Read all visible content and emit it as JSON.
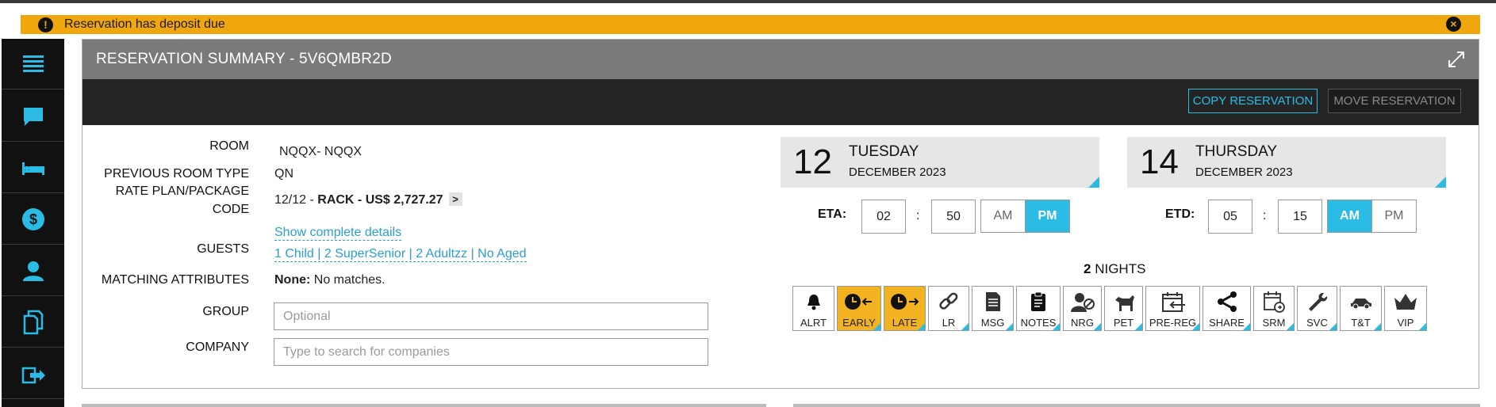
{
  "alert": {
    "text": "Reservation has deposit due",
    "icon": "exclamation-icon",
    "close_icon": "close-icon"
  },
  "sidebar": {
    "items": [
      {
        "icon": "menu-icon"
      },
      {
        "icon": "chat-icon"
      },
      {
        "icon": "bed-icon"
      },
      {
        "icon": "dollar-icon"
      },
      {
        "icon": "user-icon"
      },
      {
        "icon": "documents-icon"
      },
      {
        "icon": "export-icon"
      }
    ]
  },
  "header": {
    "title": "RESERVATION SUMMARY - 5V6QMBR2D",
    "copy_label": "COPY RESERVATION",
    "move_label": "MOVE RESERVATION"
  },
  "details": {
    "room_label": "ROOM",
    "room_value": "NQQX- NQQX",
    "prev_room_type_label": "PREVIOUS ROOM TYPE",
    "prev_room_type_value": "QN",
    "rate_plan_label_1": "RATE PLAN/PACKAGE",
    "rate_plan_label_2": "CODE",
    "rate_plan_prefix": "12/12 - ",
    "rate_plan_bold": "RACK - US$ 2,727.27",
    "rate_plan_chevron": ">",
    "show_details_link": "Show complete details",
    "guests_label": "GUESTS",
    "guests_value": "1 Child | 2 SuperSenior | 2 Adultzz | No Aged",
    "matching_label": "MATCHING ATTRIBUTES",
    "matching_bold": "None:",
    "matching_text": "No matches.",
    "group_label": "GROUP",
    "group_placeholder": "Optional",
    "company_label": "COMPANY",
    "company_placeholder": "Type to search for companies"
  },
  "arrival": {
    "day": "12",
    "weekday": "TUESDAY",
    "month": "DECEMBER 2023",
    "time_label": "ETA:",
    "hour": "02",
    "colon": ":",
    "minute": "50",
    "am": "AM",
    "pm": "PM",
    "selected": "PM"
  },
  "departure": {
    "day": "14",
    "weekday": "THURSDAY",
    "month": "DECEMBER 2023",
    "time_label": "ETD:",
    "hour": "05",
    "colon": ":",
    "minute": "15",
    "am": "AM",
    "pm": "PM",
    "selected": "AM"
  },
  "nights": {
    "count": "2",
    "label": "NIGHTS"
  },
  "flags": [
    {
      "label": "ALRT",
      "icon": "bell-icon",
      "active": false,
      "corner": false
    },
    {
      "label": "EARLY",
      "icon": "early-clock-icon",
      "active": true,
      "corner": true
    },
    {
      "label": "LATE",
      "icon": "late-clock-icon",
      "active": true,
      "corner": true
    },
    {
      "label": "LR",
      "icon": "link-icon",
      "active": false,
      "corner": true
    },
    {
      "label": "MSG",
      "icon": "message-doc-icon",
      "active": false,
      "corner": true
    },
    {
      "label": "NOTES",
      "icon": "clipboard-icon",
      "active": false,
      "corner": true
    },
    {
      "label": "NRG",
      "icon": "no-user-icon",
      "active": false,
      "corner": true
    },
    {
      "label": "PET",
      "icon": "dog-icon",
      "active": false,
      "corner": true
    },
    {
      "label": "PRE-REG",
      "icon": "calendar-arrow-icon",
      "active": false,
      "corner": true
    },
    {
      "label": "SHARE",
      "icon": "share-icon",
      "active": false,
      "corner": true
    },
    {
      "label": "SRM",
      "icon": "calendar-clock-icon",
      "active": false,
      "corner": true
    },
    {
      "label": "SVC",
      "icon": "wrench-icon",
      "active": false,
      "corner": true
    },
    {
      "label": "T&T",
      "icon": "car-icon",
      "active": false,
      "corner": true
    },
    {
      "label": "VIP",
      "icon": "crown-icon",
      "active": false,
      "corner": true
    }
  ],
  "colors": {
    "accent": "#2bbce6",
    "alert": "#f0a70d",
    "flag_active": "#f3b21f",
    "header": "#7a7a7a",
    "action_bar": "#242424"
  }
}
